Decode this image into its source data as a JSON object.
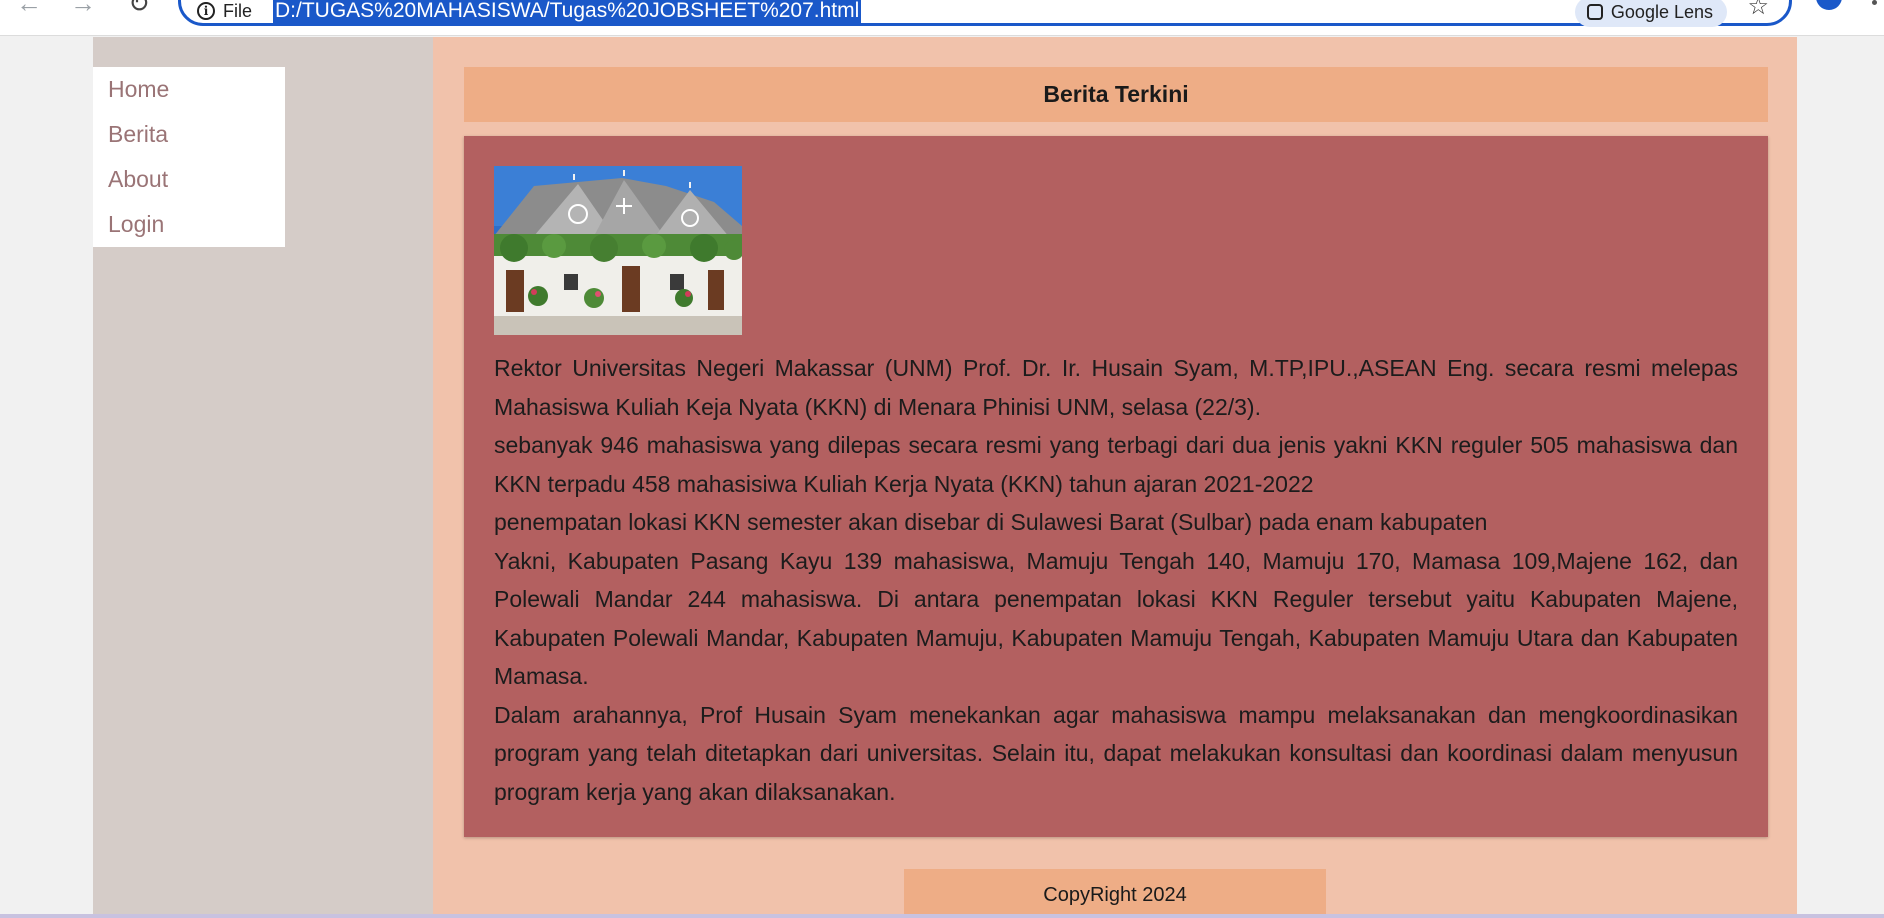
{
  "browser": {
    "site_info_label": "File",
    "url": "D:/TUGAS%20MAHASISWA/Tugas%20JOBSHEET%207.html",
    "lens_label": "Google Lens"
  },
  "nav": {
    "items": [
      {
        "label": "Home"
      },
      {
        "label": "Berita"
      },
      {
        "label": "About"
      },
      {
        "label": "Login"
      }
    ]
  },
  "main": {
    "header_title": "Berita Terkini",
    "paragraphs": [
      "Rektor Universitas Negeri Makassar (UNM) Prof. Dr. Ir. Husain Syam, M.TP,IPU.,ASEAN Eng. secara resmi melepas Mahasiswa Kuliah Keja Nyata (KKN) di Menara Phinisi UNM, selasa (22/3).",
      "sebanyak 946 mahasiswa yang dilepas secara resmi yang terbagi dari dua jenis yakni KKN reguler 505 mahasiswa dan KKN terpadu 458 mahasisiwa Kuliah Kerja Nyata (KKN) tahun ajaran 2021-2022",
      "penempatan lokasi KKN semester akan disebar di Sulawesi Barat (Sulbar) pada enam kabupaten",
      "Yakni, Kabupaten Pasang Kayu 139 mahasiswa, Mamuju Tengah 140, Mamuju 170, Mamasa 109,Majene 162, dan Polewali Mandar 244 mahasiswa. Di antara penempatan lokasi KKN Reguler tersebut yaitu Kabupaten Majene, Kabupaten Polewali Mandar, Kabupaten Mamuju, Kabupaten Mamuju Tengah, Kabupaten Mamuju Utara dan Kabupaten Mamasa.",
      "Dalam arahannya, Prof Husain Syam menekankan agar mahasiswa mampu melaksanakan dan mengkoordinasikan program yang telah ditetapkan dari universitas. Selain itu, dapat melakukan konsultasi dan koordinasi dalam menyusun program kerja yang akan dilaksanakan."
    ],
    "footer_text": "CopyRight 2024"
  },
  "colors": {
    "sidebar_bg": "#d5ccc8",
    "main_bg": "#f1c2ab",
    "header_bg": "#eead86",
    "article_bg": "#b36060",
    "nav_link": "#9a7476"
  }
}
